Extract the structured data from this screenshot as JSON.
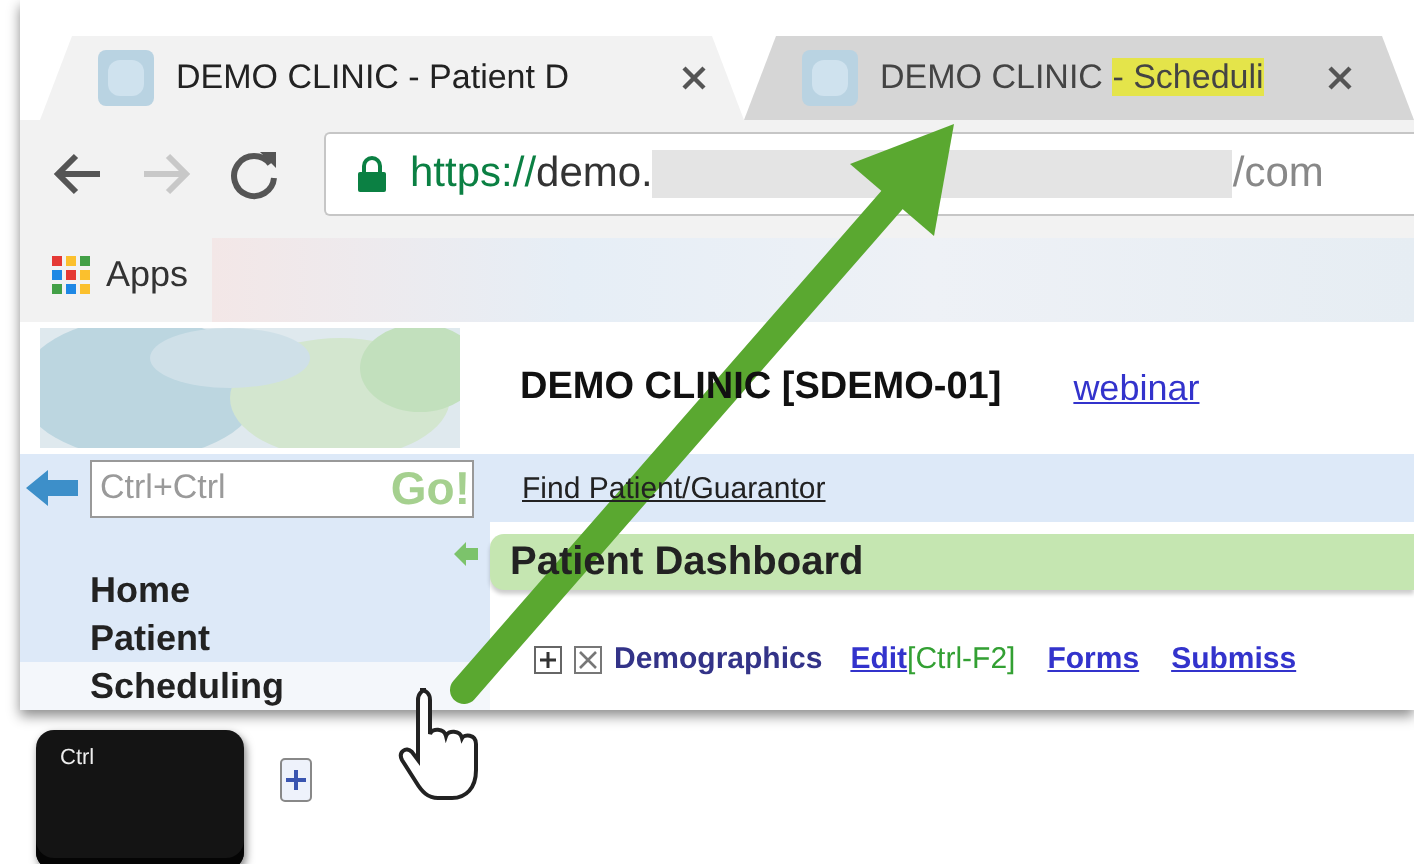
{
  "tabs": [
    {
      "title": "DEMO CLINIC - Patient D",
      "selected": true
    },
    {
      "title": "DEMO CLINIC ",
      "highlight": "- Scheduli",
      "selected": false
    }
  ],
  "toolbar": {
    "forward": {
      "disabled": true
    },
    "address": {
      "scheme": "https://",
      "host": "demo.",
      "end": "/com"
    }
  },
  "bookmarks": [
    {
      "label": "Apps"
    }
  ],
  "page": {
    "title": "DEMO CLINIC [SDEMO-01]",
    "link": "webinar",
    "search": {
      "placeholder": "Ctrl+Ctrl",
      "button": "Go!"
    },
    "find_link": "Find Patient/Guarantor",
    "nav": [
      {
        "label": "Home",
        "selected": false
      },
      {
        "label": "Patient",
        "selected": false
      },
      {
        "label": "Scheduling",
        "selected": true
      }
    ],
    "panel_title": "Patient Dashboard",
    "section": {
      "title": "Demographics",
      "actions": [
        {
          "label": "Edit",
          "shortcut": "[Ctrl-F2]"
        },
        {
          "label": "Forms"
        },
        {
          "label": "Submiss"
        }
      ]
    }
  },
  "keys": [
    {
      "label": "Ctrl"
    }
  ]
}
